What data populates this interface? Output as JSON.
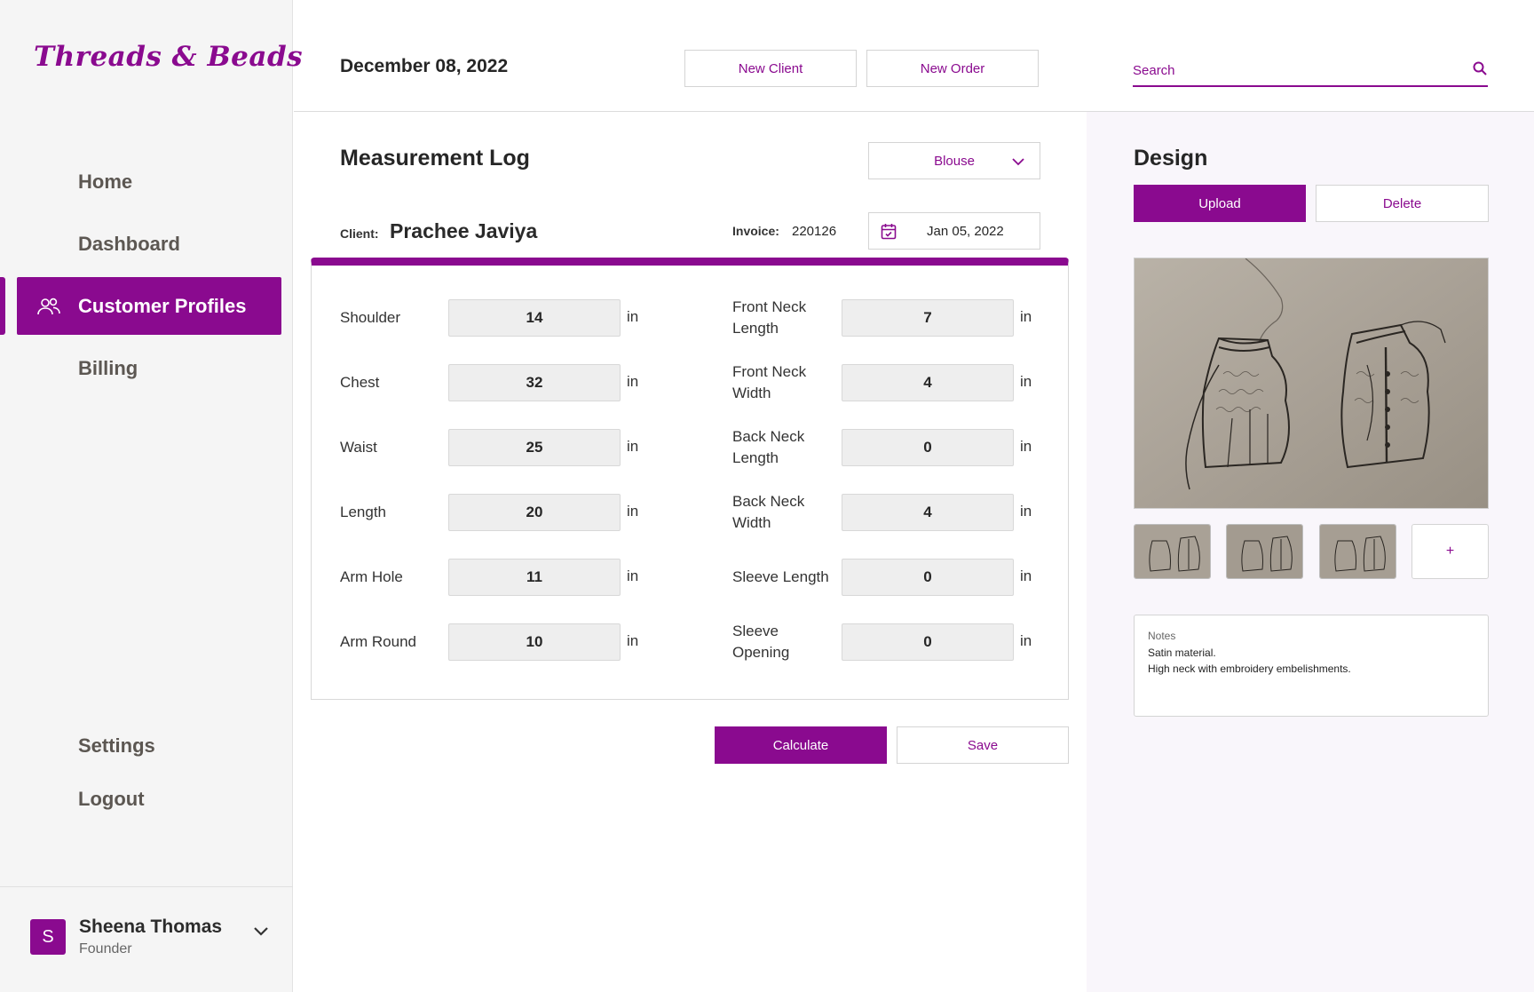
{
  "app": {
    "logo": "Threads & Beads",
    "brand_color": "#8a0a8f"
  },
  "sidebar": {
    "items": [
      {
        "label": "Home"
      },
      {
        "label": "Dashboard"
      },
      {
        "label": "Customer Profiles",
        "active": true,
        "icon": "users-icon"
      },
      {
        "label": "Billing"
      }
    ],
    "bottom_items": [
      {
        "label": "Settings"
      },
      {
        "label": "Logout"
      }
    ],
    "user": {
      "initial": "S",
      "name": "Sheena Thomas",
      "role": "Founder"
    }
  },
  "header": {
    "date": "December 08, 2022",
    "new_client": "New Client",
    "new_order": "New Order",
    "search_placeholder": "Search"
  },
  "measurement": {
    "title": "Measurement Log",
    "garment_type": "Blouse",
    "client_label": "Client:",
    "client_name": "Prachee Javiya",
    "invoice_label": "Invoice:",
    "invoice_number": "220126",
    "order_date": "Jan 05, 2022",
    "unit": "in",
    "left_fields": [
      {
        "label": "Shoulder",
        "value": "14"
      },
      {
        "label": "Chest",
        "value": "32"
      },
      {
        "label": "Waist",
        "value": "25"
      },
      {
        "label": "Length",
        "value": "20"
      },
      {
        "label": "Arm Hole",
        "value": "11"
      },
      {
        "label": "Arm Round",
        "value": "10"
      }
    ],
    "right_fields": [
      {
        "label_line1": "Front Neck",
        "label_line2": "Length",
        "value": "7"
      },
      {
        "label_line1": "Front Neck",
        "label_line2": "Width",
        "value": "4"
      },
      {
        "label_line1": "Back Neck",
        "label_line2": "Length",
        "value": "0"
      },
      {
        "label_line1": "Back Neck",
        "label_line2": "Width",
        "value": "4"
      },
      {
        "label_line1": "Sleeve Length",
        "label_line2": "",
        "value": "0"
      },
      {
        "label_line1": "Sleeve",
        "label_line2": "Opening",
        "value": "0"
      }
    ],
    "calculate": "Calculate",
    "save": "Save"
  },
  "design": {
    "title": "Design",
    "upload": "Upload",
    "delete": "Delete",
    "add_thumb": "+",
    "notes_label": "Notes",
    "notes_line1": "Satin material.",
    "notes_line2": "High neck with embroidery embelishments."
  }
}
